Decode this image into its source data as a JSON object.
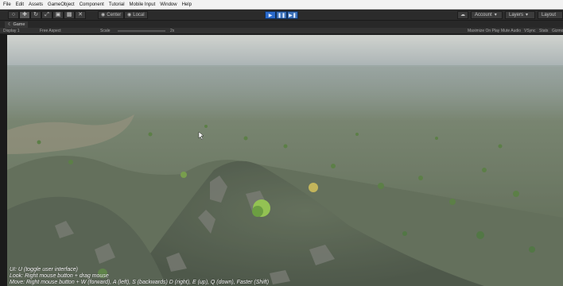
{
  "menubar": {
    "items": [
      "File",
      "Edit",
      "Assets",
      "GameObject",
      "Component",
      "Tutorial",
      "Mobile Input",
      "Window",
      "Help"
    ]
  },
  "toolbar": {
    "pivot_label": "Center",
    "space_label": "Local",
    "account_label": "Account",
    "layers_label": "Layers",
    "layout_label": "Layout",
    "play_icons": [
      "play-icon",
      "pause-icon",
      "step-icon"
    ]
  },
  "game_tab": {
    "label": "Game"
  },
  "gamebar": {
    "display": "Display 1",
    "aspect": "Free Aspect",
    "scale_label": "Scale",
    "scale_value": "2x",
    "maximize": "Maximize On Play",
    "mute": "Mute Audio",
    "vsync": "VSync",
    "stats": "Stats",
    "gizmos": "Gizmos"
  },
  "help": {
    "line1": "UI: U (toggle user interface)",
    "line2": "Look: Right mouse button + drag mouse",
    "line3": "Move: Right mouse button + W (forward), A (left), S (backwards) D (right), E (up), Q (down), Faster (Shift)"
  },
  "colors": {
    "sky_top": "#c9ccc8",
    "sky_horizon": "#aeb6b7",
    "haze": "#8e9c98",
    "terrain_dark": "#3d4a3a",
    "terrain_mid": "#5c6b52",
    "rock": "#6f6f69",
    "tree": "#3f6b2e",
    "tree_highlight": "#8ec63f",
    "tree_yellow": "#c8b648"
  }
}
